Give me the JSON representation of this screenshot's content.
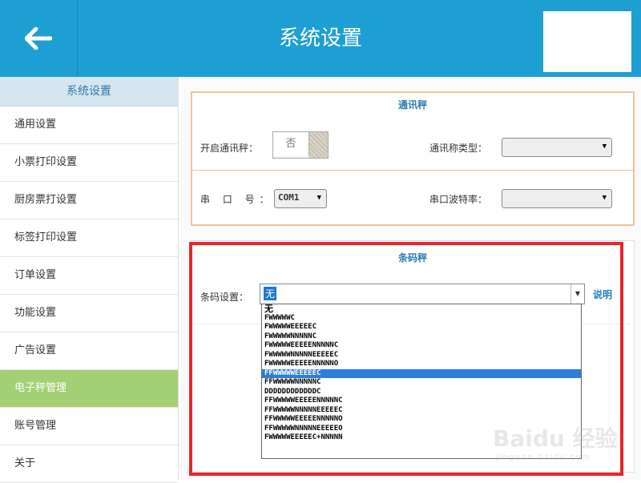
{
  "header": {
    "title": "系统设置",
    "back_icon": "arrow-left-icon"
  },
  "sidebar": {
    "title": "系统设置",
    "items": [
      {
        "label": "通用设置"
      },
      {
        "label": "小票打印设置"
      },
      {
        "label": "厨房票打设置"
      },
      {
        "label": "标签打印设置"
      },
      {
        "label": "订单设置"
      },
      {
        "label": "功能设置"
      },
      {
        "label": "广告设置"
      },
      {
        "label": "电子秤管理",
        "active": true
      },
      {
        "label": "账号管理"
      },
      {
        "label": "关于"
      }
    ],
    "active_color": "#a3d074"
  },
  "comm_scale": {
    "title": "通讯秤",
    "enable_label": "开启通讯秤：",
    "enable_value": "否",
    "type_label": "通讯称类型：",
    "type_value": "",
    "port_label": "串 口 号：",
    "port_value": "COM1",
    "baud_label": "串口波特率：",
    "baud_value": ""
  },
  "barcode_scale": {
    "title": "条码秤",
    "setting_label": "条码设置：",
    "setting_value": "无",
    "help_link": "说明",
    "options": [
      "无",
      "FWWWWWC",
      "FWWWWWEEEEEC",
      "FWWWWWNNNNNC",
      "FWWWWWEEEEENNNNNC",
      "FWWWWWNNNNNEEEEEC",
      "FWWWWWEEEEENNNNNO",
      "FFWWWWWEEEEEC",
      "FFWWWWWNNNNNC",
      "DDDDDDDDDDDDC",
      "FFWWWWWEEEEENNNNNC",
      "FFWWWWWNNNNNEEEEEC",
      "FFWWWWWEEEEENNNNNO",
      "FFWWWWWNNNNNEEEEEO",
      "FWWWWWEEEEEC+NNNNN"
    ],
    "selected_index": 7,
    "highlight_color": "#e8262b"
  },
  "watermark": {
    "text": "Baidu 经验",
    "url": "jingyan.baidu.com"
  },
  "colors": {
    "header": "#1e9fd4",
    "accent_blue": "#2b7bb0"
  }
}
